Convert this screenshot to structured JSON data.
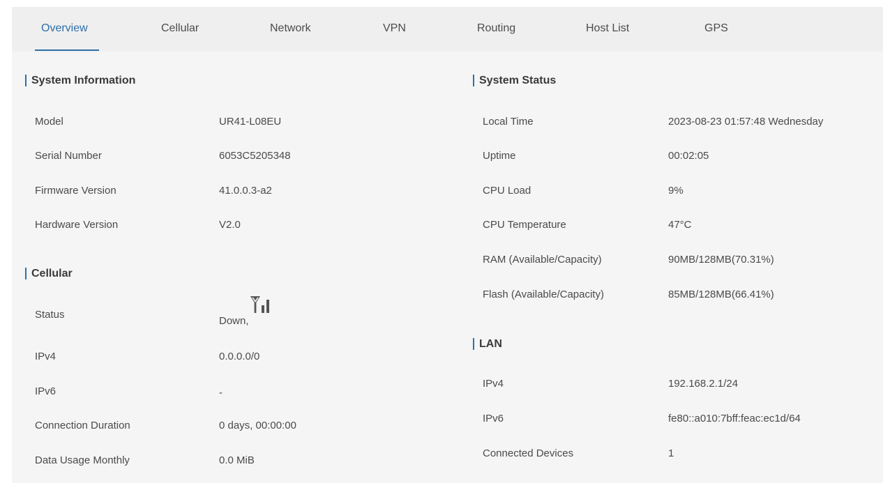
{
  "tabs": [
    {
      "label": "Overview",
      "active": true
    },
    {
      "label": "Cellular"
    },
    {
      "label": "Network"
    },
    {
      "label": "VPN"
    },
    {
      "label": "Routing"
    },
    {
      "label": "Host List"
    },
    {
      "label": "GPS"
    }
  ],
  "system_information": {
    "title": "System Information",
    "rows": [
      {
        "label": "Model",
        "value": "UR41-L08EU"
      },
      {
        "label": "Serial Number",
        "value": "6053C5205348"
      },
      {
        "label": "Firmware Version",
        "value": "41.0.0.3-a2"
      },
      {
        "label": "Hardware Version",
        "value": "V2.0"
      }
    ]
  },
  "cellular": {
    "title": "Cellular",
    "rows": [
      {
        "label": "Status",
        "value": "Down,",
        "icon": "signal-antenna-icon"
      },
      {
        "label": "IPv4",
        "value": "0.0.0.0/0"
      },
      {
        "label": "IPv6",
        "value": "-"
      },
      {
        "label": "Connection Duration",
        "value": "0 days, 00:00:00"
      },
      {
        "label": "Data Usage Monthly",
        "value": "0.0 MiB"
      }
    ]
  },
  "system_status": {
    "title": "System Status",
    "rows": [
      {
        "label": "Local Time",
        "value": "2023-08-23 01:57:48 Wednesday"
      },
      {
        "label": "Uptime",
        "value": "00:02:05"
      },
      {
        "label": "CPU Load",
        "value": "9%"
      },
      {
        "label": "CPU Temperature",
        "value": "47°C"
      },
      {
        "label": "RAM (Available/Capacity)",
        "value": "90MB/128MB(70.31%)"
      },
      {
        "label": "Flash (Available/Capacity)",
        "value": "85MB/128MB(66.41%)"
      }
    ]
  },
  "lan": {
    "title": "LAN",
    "rows": [
      {
        "label": "IPv4",
        "value": "192.168.2.1/24"
      },
      {
        "label": "IPv6",
        "value": "fe80::a010:7bff:feac:ec1d/64"
      },
      {
        "label": "Connected Devices",
        "value": "1"
      }
    ]
  },
  "colors": {
    "accent": "#2d6ea6",
    "panel_background": "#f5f5f5",
    "tabbar_background": "#efefef",
    "text": "#4a4a4a"
  }
}
